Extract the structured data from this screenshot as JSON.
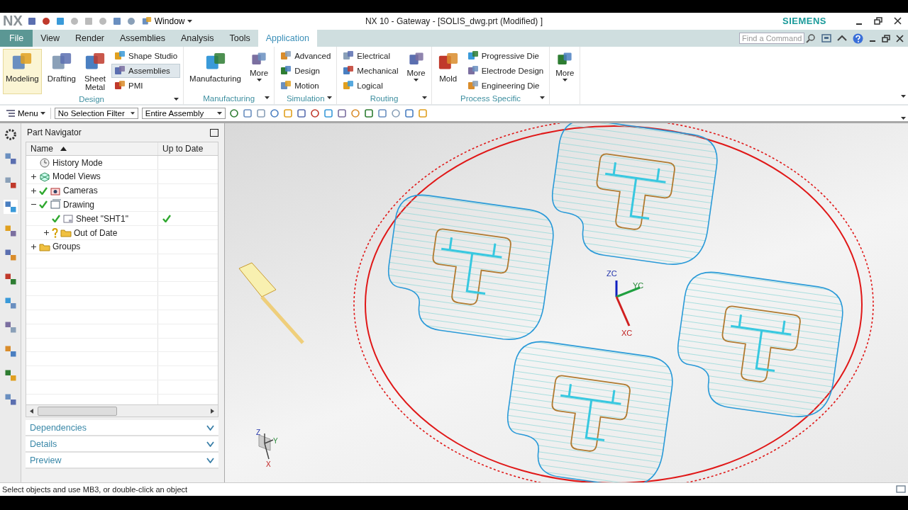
{
  "title_bar": {
    "logo": "NX",
    "window_menu": "Window",
    "title": "NX 10 - Gateway - [SOLIS_dwg.prt (Modified) ]",
    "brand": "SIEMENS"
  },
  "tabs": [
    {
      "label": "File",
      "kind": "file",
      "selected": false
    },
    {
      "label": "View",
      "kind": "tab",
      "selected": false
    },
    {
      "label": "Render",
      "kind": "tab",
      "selected": false
    },
    {
      "label": "Assemblies",
      "kind": "tab",
      "selected": false
    },
    {
      "label": "Analysis",
      "kind": "tab",
      "selected": false
    },
    {
      "label": "Tools",
      "kind": "tab",
      "selected": false
    },
    {
      "label": "Application",
      "kind": "tab",
      "selected": true
    }
  ],
  "command_search": {
    "placeholder": "Find a Command"
  },
  "ribbon": [
    {
      "label": "Design",
      "items": [
        {
          "label": "Modeling",
          "kind": "large",
          "selected": true
        },
        {
          "label": "Drafting",
          "kind": "large",
          "selected": false
        },
        {
          "label": "Sheet Metal",
          "kind": "large",
          "selected": false
        },
        {
          "label": "Shape Studio",
          "kind": "small",
          "selected": false
        },
        {
          "label": "Assemblies",
          "kind": "small",
          "selected": true
        },
        {
          "label": "PMI",
          "kind": "small",
          "selected": false
        }
      ]
    },
    {
      "label": "Manufacturing",
      "items": [
        {
          "label": "Manufacturing",
          "kind": "large",
          "selected": false
        },
        {
          "label": "More",
          "kind": "more",
          "selected": false
        }
      ]
    },
    {
      "label": "Simulation",
      "items": [
        {
          "label": "Advanced",
          "kind": "small",
          "selected": false
        },
        {
          "label": "Design",
          "kind": "small",
          "selected": false
        },
        {
          "label": "Motion",
          "kind": "small",
          "selected": false
        }
      ]
    },
    {
      "label": "Routing",
      "items": [
        {
          "label": "Electrical",
          "kind": "small",
          "selected": false
        },
        {
          "label": "Mechanical",
          "kind": "small",
          "selected": false
        },
        {
          "label": "Logical",
          "kind": "small",
          "selected": false
        },
        {
          "label": "More",
          "kind": "more",
          "selected": false
        }
      ]
    },
    {
      "label": "Process Specific",
      "items": [
        {
          "label": "Mold",
          "kind": "large",
          "selected": false
        },
        {
          "label": "Progressive Die",
          "kind": "small",
          "selected": false
        },
        {
          "label": "Electrode Design",
          "kind": "small",
          "selected": false
        },
        {
          "label": "Engineering Die",
          "kind": "small",
          "selected": false
        }
      ]
    },
    {
      "items": [
        {
          "label": "More",
          "kind": "more",
          "selected": false
        }
      ]
    }
  ],
  "toolbar": {
    "menu": "Menu",
    "selection_filter": "No Selection Filter",
    "selection_scope": "Entire Assembly"
  },
  "navigator": {
    "title": "Part Navigator",
    "columns": [
      "Name",
      "Up to Date"
    ],
    "tree": [
      {
        "label": "History Mode",
        "kind": "history",
        "checked": false,
        "up_to_date": false
      },
      {
        "label": "Model Views",
        "kind": "views",
        "expanded": false,
        "checked": false,
        "up_to_date": false
      },
      {
        "label": "Cameras",
        "kind": "camera",
        "expanded": false,
        "checked": true,
        "up_to_date": false
      },
      {
        "label": "Drawing",
        "kind": "drawing",
        "expanded": true,
        "checked": true,
        "up_to_date": false,
        "children": [
          {
            "label": "Sheet \"SHT1\"",
            "kind": "sheet",
            "checked": true,
            "up_to_date": true
          },
          {
            "label": "Out of Date",
            "kind": "unknown-folder",
            "expanded": false,
            "checked": false,
            "up_to_date": false
          }
        ]
      },
      {
        "label": "Groups",
        "kind": "folder",
        "expanded": false,
        "checked": false,
        "up_to_date": false
      }
    ],
    "panels": [
      {
        "label": "Dependencies",
        "expanded": false
      },
      {
        "label": "Details",
        "expanded": false
      },
      {
        "label": "Preview",
        "expanded": false
      }
    ]
  },
  "graphics": {
    "wcs_labels": [
      "ZC",
      "YC",
      "XC"
    ],
    "view_triad_labels": [
      "Z",
      "Y",
      "X"
    ]
  },
  "status_bar": {
    "message": "Select objects and use MB3, or double-click an object"
  }
}
